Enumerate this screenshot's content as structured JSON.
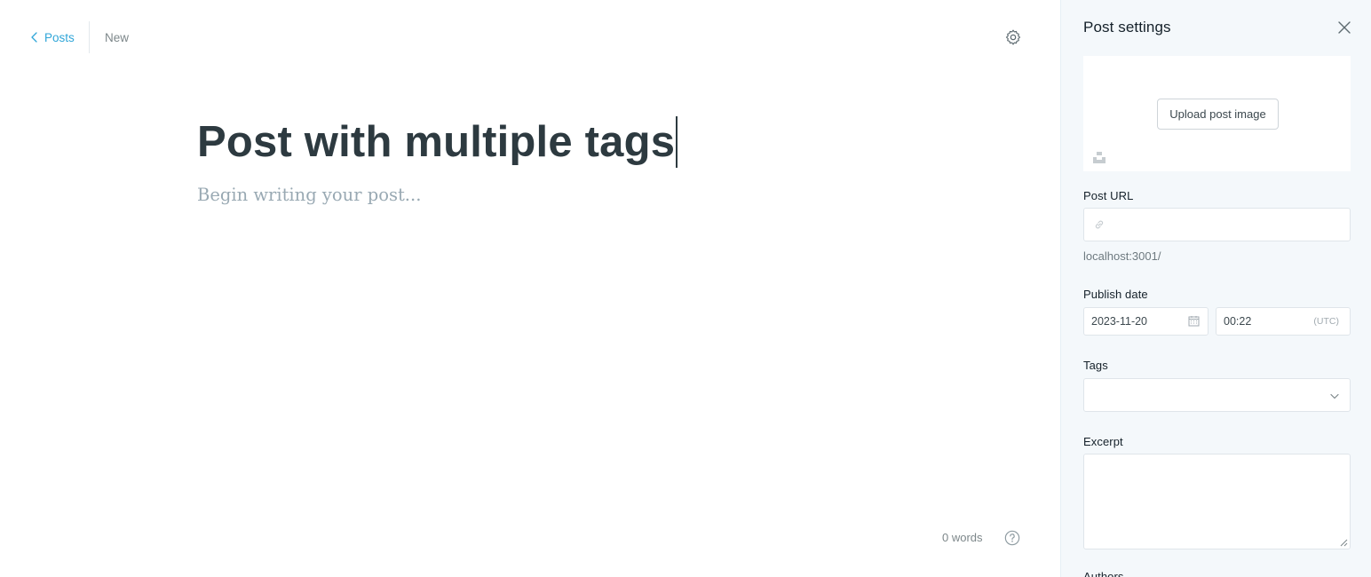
{
  "editor": {
    "breadcrumb": {
      "back_label": "Posts",
      "status": "New"
    },
    "title": "Post with multiple tags",
    "body_placeholder": "Begin writing your post...",
    "word_count": "0 words"
  },
  "settings": {
    "title": "Post settings",
    "upload_label": "Upload post image",
    "url": {
      "label": "Post URL",
      "value": "",
      "hint": "localhost:3001/"
    },
    "publish_date": {
      "label": "Publish date",
      "date": "2023-11-20",
      "time": "00:22",
      "timezone": "(UTC)"
    },
    "tags": {
      "label": "Tags"
    },
    "excerpt": {
      "label": "Excerpt",
      "value": ""
    },
    "authors": {
      "label": "Authors"
    }
  },
  "colors": {
    "accent": "#30a6d8",
    "panel_bg": "#f4f8fb",
    "title_text": "#2d3a40",
    "placeholder": "#99a9b3"
  },
  "icons": [
    "chevron-left-icon",
    "gear-icon",
    "help-icon",
    "close-icon",
    "unsplash-icon",
    "link-icon",
    "calendar-icon",
    "chevron-down-icon"
  ]
}
